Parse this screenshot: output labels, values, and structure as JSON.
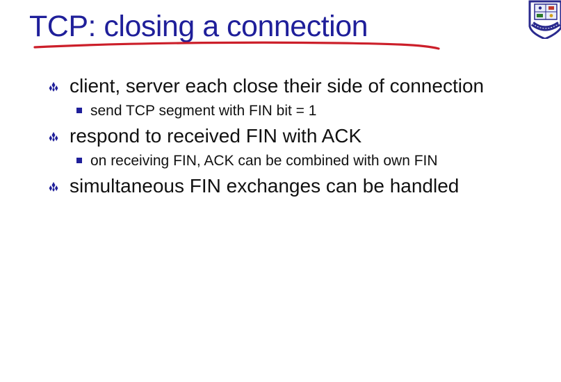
{
  "slide": {
    "title": "TCP: closing a connection",
    "accent_color": "#1f1f9a",
    "underline_color": "#cc1f2a",
    "logo_icon": "university-seal-icon",
    "bullets": [
      {
        "text": "client, server each close their side of connection",
        "subs": [
          "send TCP segment with FIN bit = 1"
        ]
      },
      {
        "text": "respond to received FIN with ACK",
        "subs": [
          "on receiving FIN, ACK can be combined with own FIN"
        ]
      },
      {
        "text": "simultaneous FIN exchanges can be handled",
        "subs": []
      }
    ]
  }
}
